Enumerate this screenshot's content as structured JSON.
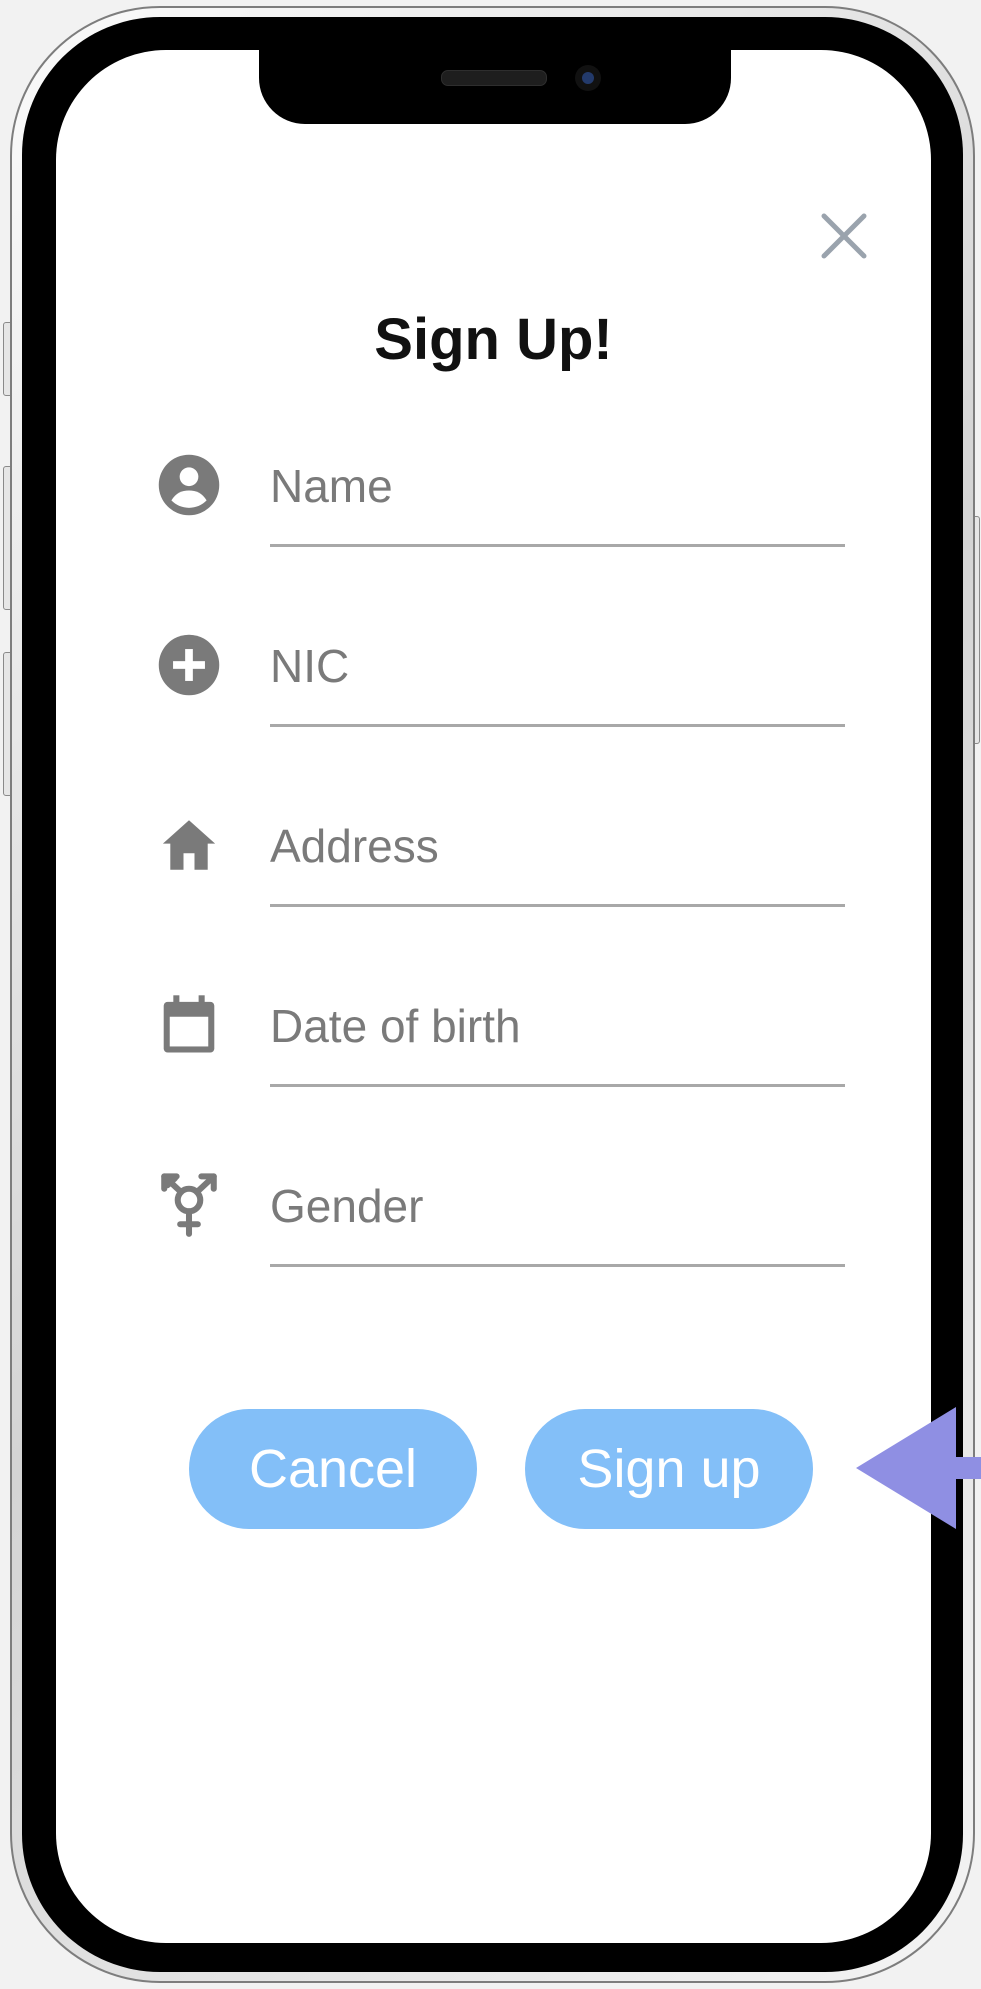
{
  "modal": {
    "title": "Sign Up!",
    "close_icon": "close-icon"
  },
  "form": {
    "fields": [
      {
        "icon": "account-circle-icon",
        "placeholder": "Name",
        "value": ""
      },
      {
        "icon": "add-circle-icon",
        "placeholder": "NIC",
        "value": ""
      },
      {
        "icon": "home-icon",
        "placeholder": "Address",
        "value": ""
      },
      {
        "icon": "calendar-icon",
        "placeholder": "Date of birth",
        "value": ""
      },
      {
        "icon": "transgender-icon",
        "placeholder": "Gender",
        "value": ""
      }
    ]
  },
  "actions": {
    "cancel_label": "Cancel",
    "signup_label": "Sign up"
  },
  "colors": {
    "button": "#83bff8",
    "icon": "#7a7a7a",
    "annotation_arrow": "#8f8fe3"
  },
  "annotation": {
    "icon": "pointer-arrow-icon"
  }
}
